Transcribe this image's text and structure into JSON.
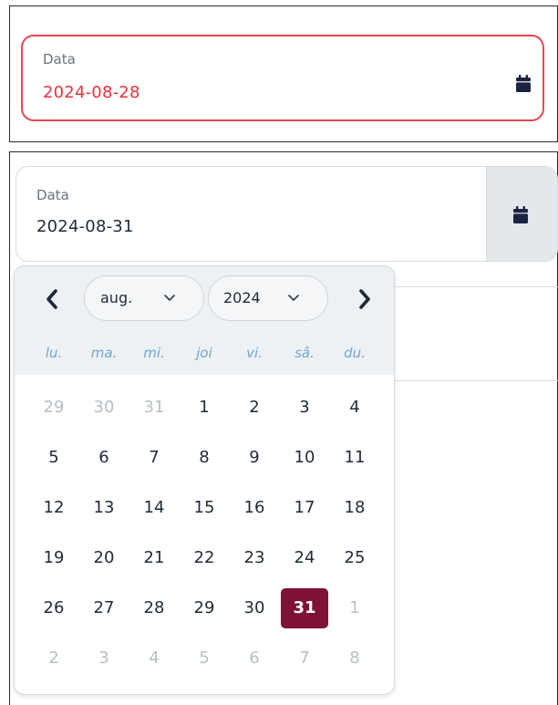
{
  "top_field": {
    "label": "Data",
    "value": "2024-08-28",
    "state_color": "#e8474f"
  },
  "bottom_field": {
    "label": "Data",
    "value": "2024-08-31"
  },
  "datepicker": {
    "month": "aug.",
    "year": "2024",
    "weekdays": [
      "lu.",
      "ma.",
      "mi.",
      "joi",
      "vi.",
      "sâ.",
      "du."
    ],
    "weeks": [
      [
        {
          "d": "29",
          "muted": true
        },
        {
          "d": "30",
          "muted": true
        },
        {
          "d": "31",
          "muted": true
        },
        {
          "d": "1"
        },
        {
          "d": "2"
        },
        {
          "d": "3"
        },
        {
          "d": "4"
        }
      ],
      [
        {
          "d": "5"
        },
        {
          "d": "6"
        },
        {
          "d": "7"
        },
        {
          "d": "8"
        },
        {
          "d": "9"
        },
        {
          "d": "10"
        },
        {
          "d": "11"
        }
      ],
      [
        {
          "d": "12"
        },
        {
          "d": "13"
        },
        {
          "d": "14"
        },
        {
          "d": "15"
        },
        {
          "d": "16"
        },
        {
          "d": "17"
        },
        {
          "d": "18"
        }
      ],
      [
        {
          "d": "19"
        },
        {
          "d": "20"
        },
        {
          "d": "21"
        },
        {
          "d": "22"
        },
        {
          "d": "23"
        },
        {
          "d": "24"
        },
        {
          "d": "25"
        }
      ],
      [
        {
          "d": "26"
        },
        {
          "d": "27"
        },
        {
          "d": "28"
        },
        {
          "d": "29"
        },
        {
          "d": "30"
        },
        {
          "d": "31",
          "selected": true
        },
        {
          "d": "1",
          "muted": true
        }
      ],
      [
        {
          "d": "2",
          "muted": true
        },
        {
          "d": "3",
          "muted": true
        },
        {
          "d": "4",
          "muted": true
        },
        {
          "d": "5",
          "muted": true
        },
        {
          "d": "6",
          "muted": true
        },
        {
          "d": "7",
          "muted": true
        },
        {
          "d": "8",
          "muted": true
        }
      ]
    ],
    "selected_color": "#7d1235",
    "weekday_color": "#6fa6d6"
  },
  "icons": {
    "calendar": "calendar-icon",
    "prev": "chevron-left-icon",
    "next": "chevron-right-icon",
    "dropdown": "chevron-down-icon"
  }
}
